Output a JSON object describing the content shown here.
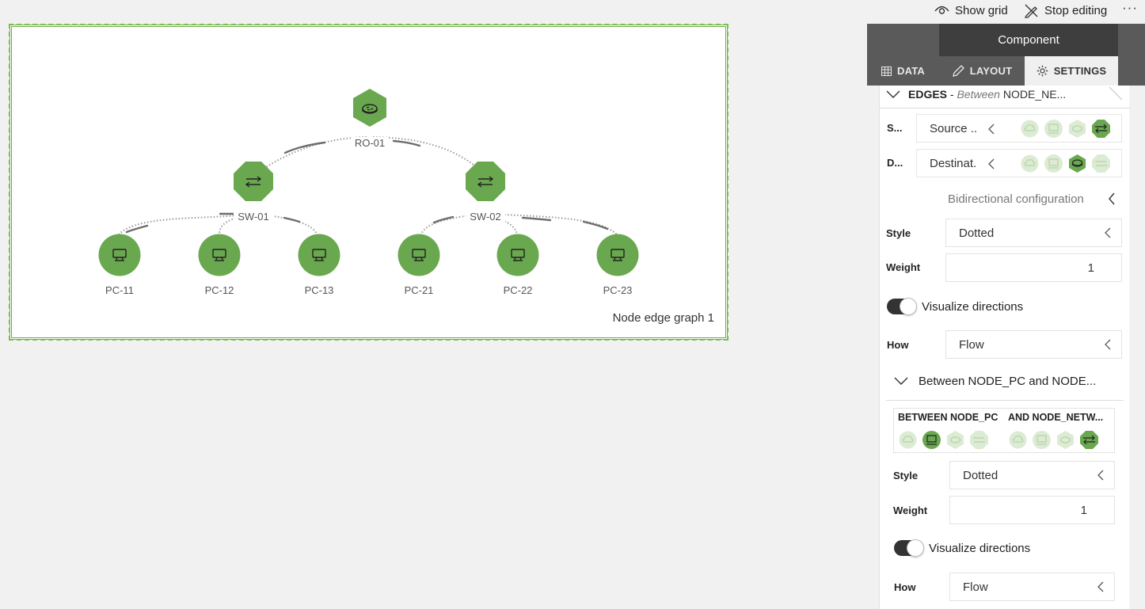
{
  "toolbar": {
    "show_grid": "Show grid",
    "stop_editing": "Stop editing",
    "more": "···"
  },
  "component": {
    "caption": "Node edge graph 1",
    "nodes": [
      {
        "id": "RO-01",
        "kind": "router"
      },
      {
        "id": "SW-01",
        "kind": "switch"
      },
      {
        "id": "SW-02",
        "kind": "switch"
      },
      {
        "id": "PC-11",
        "kind": "pc"
      },
      {
        "id": "PC-12",
        "kind": "pc"
      },
      {
        "id": "PC-13",
        "kind": "pc"
      },
      {
        "id": "PC-21",
        "kind": "pc"
      },
      {
        "id": "PC-22",
        "kind": "pc"
      },
      {
        "id": "PC-23",
        "kind": "pc"
      }
    ]
  },
  "panel": {
    "title": "Component",
    "tabs": [
      {
        "label": "DATA",
        "icon": "table-icon"
      },
      {
        "label": "LAYOUT",
        "icon": "pencil-icon"
      },
      {
        "label": "SETTINGS",
        "icon": "gear-icon",
        "active": true
      }
    ],
    "edges_heading": "EDGES",
    "edges_sep": " - ",
    "edges_between": "Between",
    "edges_tail": " NODE_NE...",
    "source_label": "S...",
    "source_value": "Source ..",
    "dest_label": "D...",
    "dest_value": "Destinat.",
    "bidirectional": "Bidirectional configuration",
    "section1": {
      "style_label": "Style",
      "style_value": "Dotted",
      "weight_label": "Weight",
      "weight_value": "1",
      "visualize": "Visualize directions",
      "how_label": "How",
      "how_value": "Flow"
    },
    "sub_heading": "Between NODE_PC and NODE...",
    "between_left": "BETWEEN NODE_PC",
    "between_right": "AND NODE_NETW...",
    "section2": {
      "style_label": "Style",
      "style_value": "Dotted",
      "weight_label": "Weight",
      "weight_value": "1",
      "visualize": "Visualize directions",
      "how_label": "How",
      "how_value": "Flow"
    }
  },
  "colors": {
    "accent": "#6aa84f",
    "accent_light": "#dcebd3",
    "panel_header": "#5a5a5a"
  }
}
